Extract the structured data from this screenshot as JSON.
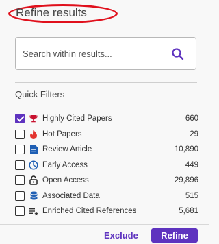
{
  "panel": {
    "title": "Refine results"
  },
  "search": {
    "placeholder": "Search within results...",
    "value": ""
  },
  "quick_filters": {
    "title": "Quick Filters",
    "items": [
      {
        "label": "Highly Cited Papers",
        "count": "660",
        "checked": true,
        "icon": "trophy-icon",
        "icon_color": "#c8102e"
      },
      {
        "label": "Hot Papers",
        "count": "29",
        "checked": false,
        "icon": "fire-icon",
        "icon_color": "#e3342f"
      },
      {
        "label": "Review Article",
        "count": "10,890",
        "checked": false,
        "icon": "document-icon",
        "icon_color": "#1f5fb4"
      },
      {
        "label": "Early Access",
        "count": "449",
        "checked": false,
        "icon": "clock-icon",
        "icon_color": "#1f5fb4"
      },
      {
        "label": "Open Access",
        "count": "29,896",
        "checked": false,
        "icon": "lock-icon",
        "icon_color": "#222222"
      },
      {
        "label": "Associated Data",
        "count": "515",
        "checked": false,
        "icon": "database-icon",
        "icon_color": "#1f5fb4"
      },
      {
        "label": "Enriched Cited References",
        "count": "5,681",
        "checked": false,
        "icon": "enriched-list-icon",
        "icon_color": "#333333"
      }
    ]
  },
  "actions": {
    "exclude_label": "Exclude",
    "refine_label": "Refine"
  },
  "colors": {
    "accent": "#5e33bf",
    "highlight": "#e0101c"
  }
}
